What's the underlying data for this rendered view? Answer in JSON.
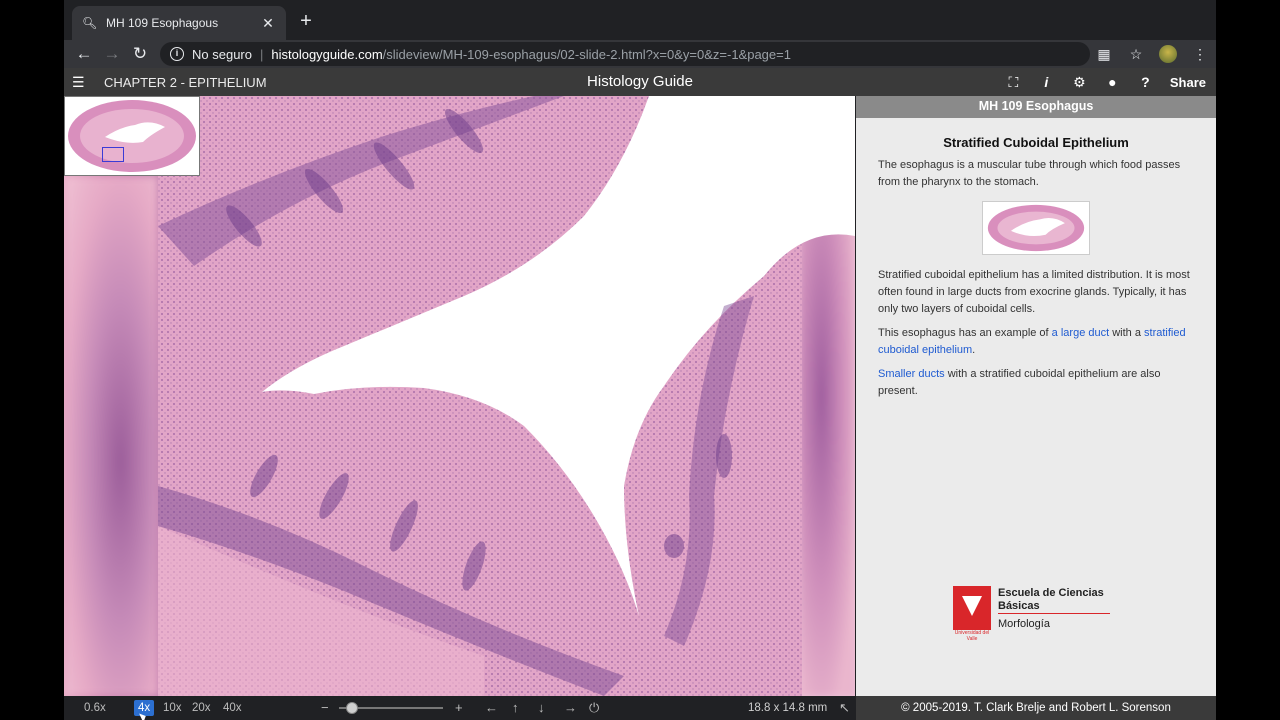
{
  "browser": {
    "tab_title": "MH 109 Esophagous",
    "favicon": "search-icon",
    "close_glyph": "✕",
    "newtab_glyph": "+",
    "security_label": "No seguro",
    "url_host": "histologyguide.com",
    "url_path": "/slideview/MH-109-esophagus/02-slide-2.html?x=0&y=0&z=-1&page=1"
  },
  "header": {
    "chapter": "CHAPTER 2 - EPITHELIUM",
    "title": "Histology Guide",
    "share_label": "Share"
  },
  "viewer": {
    "zoom_levels": [
      "0.6x",
      "4x",
      "10x",
      "20x",
      "40x"
    ],
    "active_zoom": "4x",
    "scale_readout": "18.8 x 14.8 mm",
    "colors": {
      "tissue_pink": "#e5a9c9",
      "epithelium_purple": "#7c4c94",
      "lumen": "#ffffff"
    }
  },
  "panel": {
    "header": "MH 109 Esophagus",
    "heading": "Stratified Cuboidal Epithelium",
    "para1": "The esophagus is a muscular tube through which food passes from the pharynx to the stomach.",
    "para2": "Stratified cuboidal epithelium has a limited distribution. It is most often found in large ducts from exocrine glands. Typically, it has only two layers of cuboidal cells.",
    "para3_pre": "This esophagus has an example of ",
    "para3_link1": "a large duct",
    "para3_mid": " with a ",
    "para3_link2": "stratified cuboidal epithelium",
    "para3_post": ".",
    "para4_link": "Smaller ducts",
    "para4_post": " with a stratified cuboidal epithelium are also present.",
    "logo_school": "Escuela de Ciencias Básicas",
    "logo_dept": "Morfología",
    "logo_uni": "Universidad del Valle",
    "footer": "© 2005-2019. T. Clark Brelje and Robert L. Sorenson"
  }
}
